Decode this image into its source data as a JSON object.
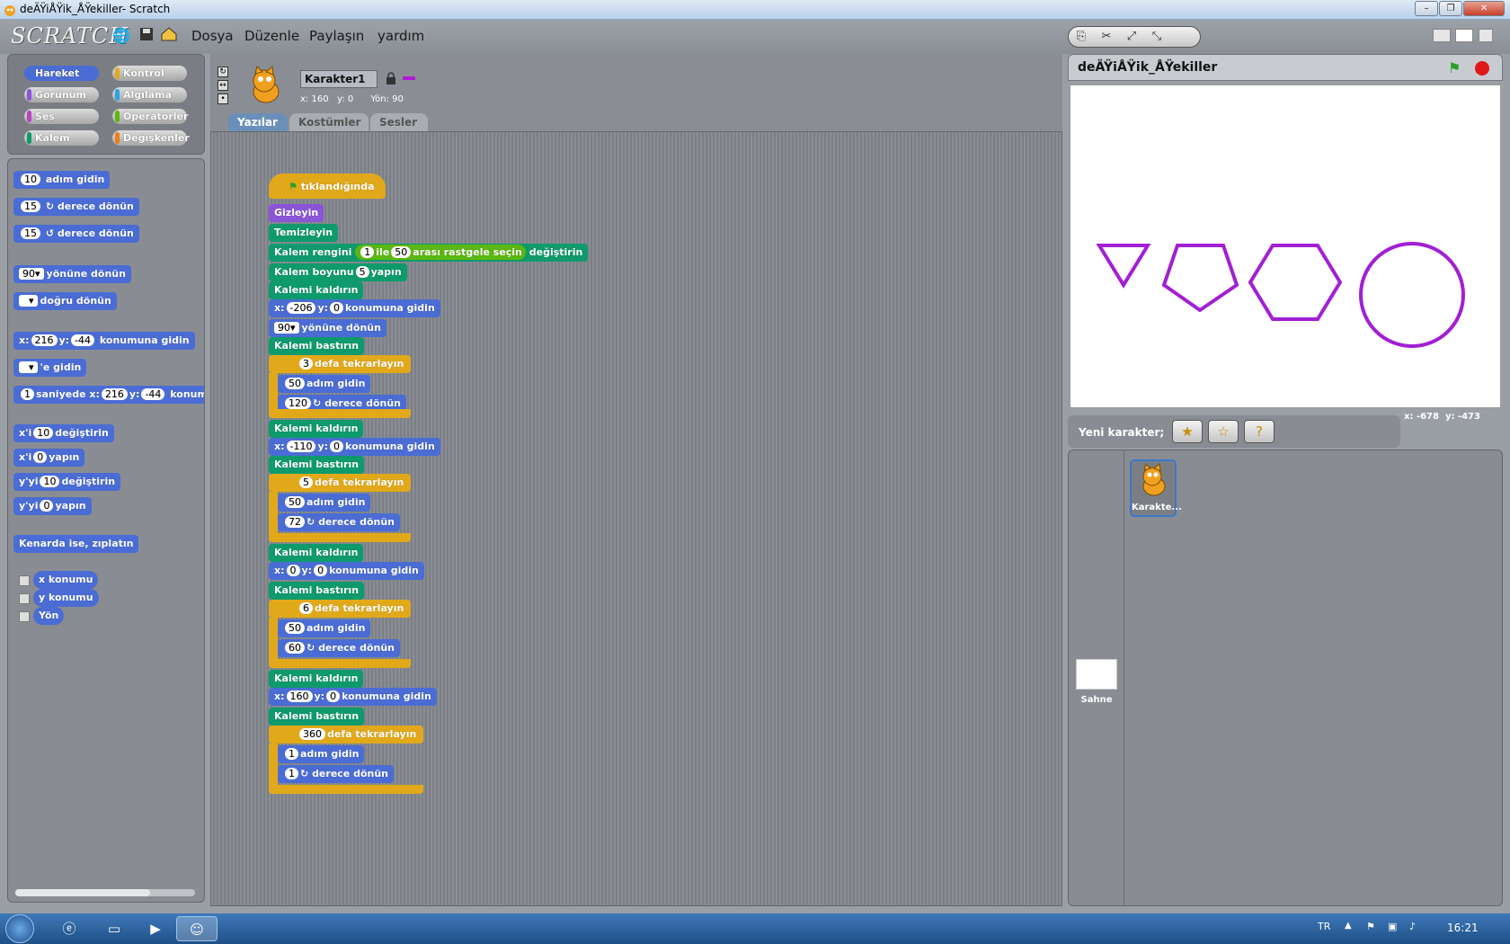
{
  "window": {
    "title": "deÄŸiÅŸik_ÅŸekiller- Scratch",
    "min": "–",
    "max": "❐",
    "close": "✕"
  },
  "menubar": {
    "logo": "SCRATCH",
    "menus": [
      "Dosya",
      "Düzenle",
      "Paylaşın",
      "yardım"
    ]
  },
  "categories": [
    {
      "label": "Hareket",
      "color": "#4a6cd4",
      "selected": true
    },
    {
      "label": "Kontrol",
      "color": "#e1a91a"
    },
    {
      "label": "Görünüm",
      "color": "#8a55d7"
    },
    {
      "label": "Algılama",
      "color": "#2ca5e2"
    },
    {
      "label": "Ses",
      "color": "#bb42c3"
    },
    {
      "label": "Operatörler",
      "color": "#5cb712"
    },
    {
      "label": "Kalem",
      "color": "#0e9a6c"
    },
    {
      "label": "Değişkenler",
      "color": "#ee7d16"
    }
  ],
  "palette": {
    "move": {
      "n": "10",
      "t": "adım gidin"
    },
    "turn_r": {
      "n": "15",
      "t": "derece dönün"
    },
    "turn_l": {
      "n": "15",
      "t": "derece dönün"
    },
    "point_dir": {
      "n": "90",
      "t": "yönüne dönün"
    },
    "point_towards": {
      "t": "doğru dönün"
    },
    "goto_xy": {
      "x_label": "x:",
      "x": "216",
      "y_label": "y:",
      "y": "-44",
      "t": "konumuna gidin"
    },
    "goto": {
      "t": "'e gidin"
    },
    "glide": {
      "n": "1",
      "t1": "saniyede x:",
      "x": "216",
      "y_label": "y:",
      "y": "-44",
      "t2": "konum"
    },
    "change_x": {
      "t1": "x'i",
      "n": "10",
      "t2": "değiştirin"
    },
    "set_x": {
      "t1": "x'i",
      "n": "0",
      "t2": "yapın"
    },
    "change_y": {
      "t1": "y'yi",
      "n": "10",
      "t2": "değiştirin"
    },
    "set_y": {
      "t1": "y'yi",
      "n": "0",
      "t2": "yapın"
    },
    "bounce": "Kenarda ise, zıplatın",
    "xpos": "x konumu",
    "ypos": "y konumu",
    "dir": "Yön"
  },
  "sprite": {
    "name": "Karakter1",
    "x_label": "x:",
    "x": "160",
    "y_label": "y:",
    "y": "0",
    "dir_label": "Yön:",
    "dir": "90",
    "pen_color": "#b01bd6"
  },
  "tabs": [
    "Yazılar",
    "Kostümler",
    "Sesler"
  ],
  "script": {
    "hat": "tıklandığında",
    "hide": "Gizleyin",
    "clear": "Temizleyin",
    "pencolor": {
      "t1": "Kalem rengini",
      "a": "1",
      "t2": "ile",
      "b": "50",
      "t3": "arası rastgele seçin",
      "t4": "değiştirin"
    },
    "pensize": {
      "t1": "Kalem boyunu",
      "n": "5",
      "t2": "yapın"
    },
    "penup": "Kalemi kaldırın",
    "pendown": "Kalemi bastırın",
    "goto_label": "konumuna gidin",
    "x_label": "x:",
    "y_label": "y:",
    "goto1": {
      "x": "-206",
      "y": "0"
    },
    "dir": {
      "n": "90",
      "t": "yönüne dönün"
    },
    "repeat_label": "defa tekrarlayın",
    "move_label": "adım gidin",
    "turn_label": "derece dönün",
    "loops": [
      {
        "times": "3",
        "steps": "50",
        "turn": "120"
      },
      {
        "times": "5",
        "steps": "50",
        "turn": "72"
      },
      {
        "times": "6",
        "steps": "50",
        "turn": "60"
      },
      {
        "times": "360",
        "steps": "1",
        "turn": "1"
      }
    ],
    "goto2": {
      "x": "-110",
      "y": "0"
    },
    "goto3": {
      "x": "0",
      "y": "0"
    },
    "goto4": {
      "x": "160",
      "y": "0"
    }
  },
  "stage": {
    "title": "deÄŸiÅŸik_ÅŸekiller",
    "mouse_x_label": "x:",
    "mouse_x": "-678",
    "mouse_y_label": "y:",
    "mouse_y": "-473"
  },
  "newsprite": {
    "label": "Yeni karakter;"
  },
  "spritelist": {
    "stage_label": "Sahne",
    "sprite_label": "Karakte..."
  },
  "taskbar": {
    "lang": "TR",
    "time": "16:21"
  }
}
